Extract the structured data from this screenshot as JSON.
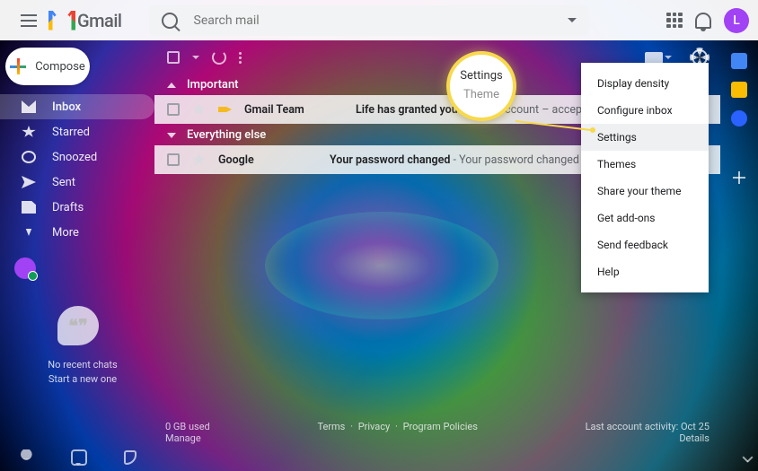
{
  "header": {
    "logo_text": "Gmail",
    "search_placeholder": "Search mail",
    "avatar_letter": "L"
  },
  "compose_label": "Compose",
  "sidebar": {
    "items": [
      {
        "label": "Inbox"
      },
      {
        "label": "Starred"
      },
      {
        "label": "Snoozed"
      },
      {
        "label": "Sent"
      },
      {
        "label": "Drafts"
      },
      {
        "label": "More"
      }
    ]
  },
  "sections": {
    "important": "Important",
    "everything_else": "Everything else"
  },
  "mails": [
    {
      "sender": "Gmail Team",
      "subject": "Life has granted you access",
      "preview": " account – accept "
    },
    {
      "sender": "Google",
      "subject": "Your password changed",
      "preview": " - Your password changed Hi Life, Th"
    }
  ],
  "settings_menu": {
    "items": [
      "Display density",
      "Configure inbox",
      "Settings",
      "Themes",
      "Share your theme",
      "Get add-ons",
      "Send feedback",
      "Help"
    ]
  },
  "callout": {
    "line1": "Settings",
    "line2": "Theme"
  },
  "hangouts": {
    "empty_text": "No recent chats\nStart a new one"
  },
  "footer": {
    "storage_line1": "0 GB used",
    "storage_line2": "Manage",
    "terms": "Terms",
    "privacy": "Privacy",
    "policies": "Program Policies",
    "activity_line1": "Last account activity: Oct 25",
    "activity_line2": "Details"
  }
}
